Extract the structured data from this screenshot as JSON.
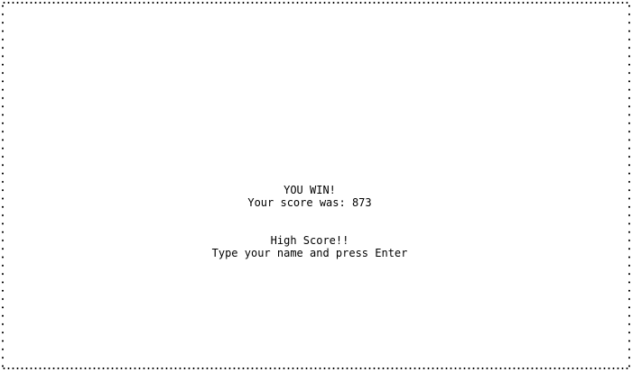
{
  "game": {
    "win_message": "YOU WIN!",
    "score_prefix": "Your score was: ",
    "score": "873",
    "high_score_message": "High Score!!",
    "name_prompt": "Type your name and press Enter"
  },
  "colors": {
    "background": "#ffffff",
    "text": "#000000",
    "border": "#000000"
  }
}
